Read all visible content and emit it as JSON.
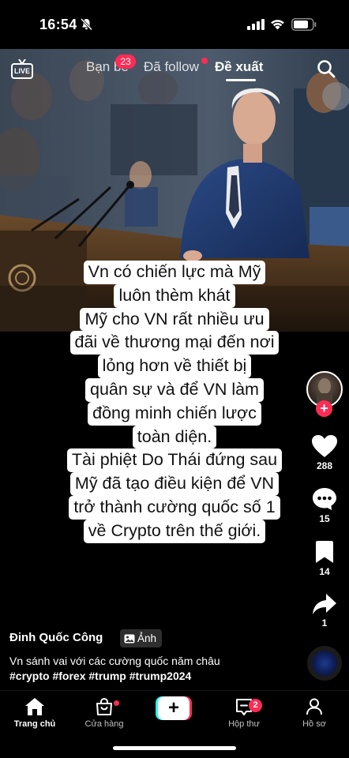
{
  "status_bar": {
    "time": "16:54"
  },
  "top_nav": {
    "live_label": "LIVE",
    "tabs": [
      {
        "label": "Bạn bè",
        "badge": "23"
      },
      {
        "label": "Đã follow"
      },
      {
        "label": "Đề xuất"
      }
    ]
  },
  "overlay_text": [
    "Vn có chiến lực mà Mỹ",
    "luôn thèm khát",
    "Mỹ cho VN rất nhiều ưu",
    "đãi về thương mại đến nơi",
    "lỏng hơn về thiết bị",
    "quân sự và để VN làm",
    "đồng minh chiến lược",
    "toàn diện.",
    "Tài phiệt Do Thái đứng sau",
    "Mỹ đã tạo điều kiện để VN",
    "trở thành cường quốc số 1",
    "về Crypto trên thế giới."
  ],
  "actions": {
    "likes": "288",
    "comments": "15",
    "saves": "14",
    "shares": "1"
  },
  "post": {
    "author": "Đinh Quốc Công",
    "photo_tag": "Ảnh",
    "description": "Vn sánh vai với các cường quốc năm châu",
    "hashtags": "#crypto #forex #trump #trump2024"
  },
  "bottom_nav": {
    "home": "Trang chủ",
    "shop": "Cửa hàng",
    "inbox": "Hộp thư",
    "inbox_badge": "2",
    "profile": "Hồ sơ"
  },
  "colors": {
    "accent": "#fe2c55",
    "cyan": "#25f4ee",
    "background": "#000000"
  },
  "icons": [
    "bell-off-icon",
    "signal-icon",
    "wifi-icon",
    "battery-icon",
    "live-icon",
    "search-icon",
    "heart-icon",
    "comment-icon",
    "bookmark-icon",
    "share-icon",
    "photo-icon",
    "home-icon",
    "shop-icon",
    "plus-icon",
    "inbox-icon",
    "profile-icon"
  ]
}
